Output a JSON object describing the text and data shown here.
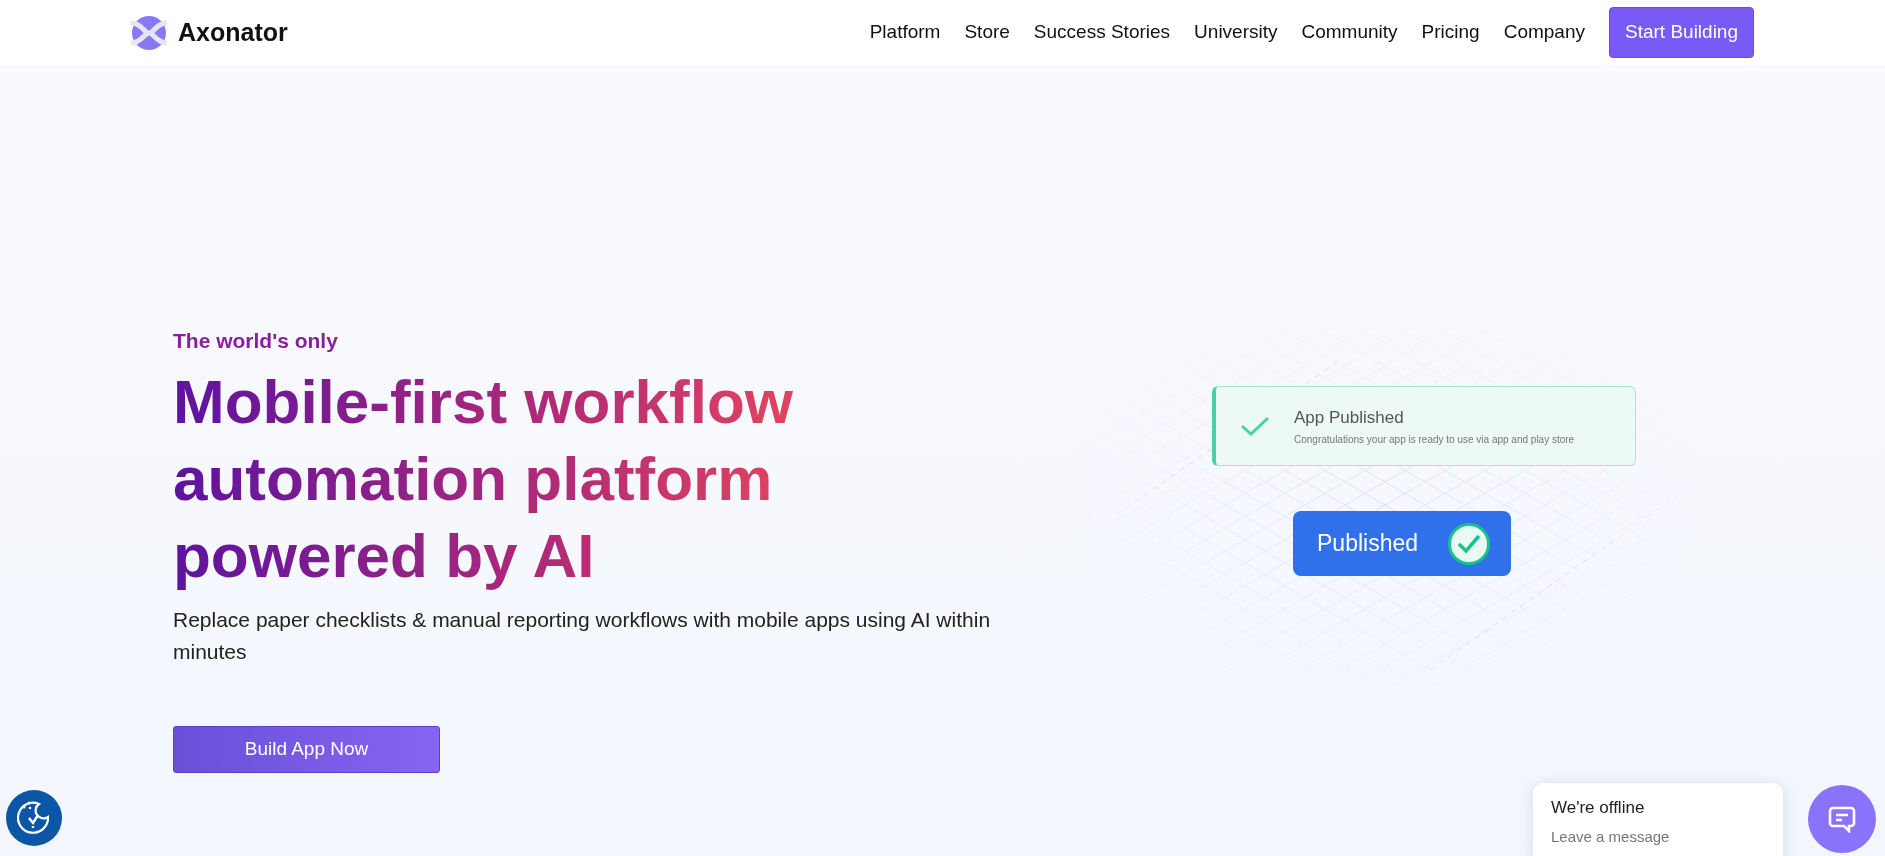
{
  "navbar": {
    "brand": "Axonator",
    "links": [
      "Platform",
      "Store",
      "Success Stories",
      "University",
      "Community",
      "Pricing",
      "Company"
    ],
    "cta": "Start Building"
  },
  "hero": {
    "eyebrow": "The world's only",
    "title_lines": [
      "Mobile-first workflow",
      "automation platform",
      "powered by AI"
    ],
    "subtitle": "Replace paper checklists & manual reporting workflows with mobile apps using AI within minutes",
    "button": "Build App Now"
  },
  "illustration": {
    "notification": {
      "title": "App Published",
      "text": "Congratulations your app is ready to use via app and play store"
    },
    "badge": "Published"
  },
  "chat": {
    "title": "We're offline",
    "subtitle": "Leave a message"
  }
}
